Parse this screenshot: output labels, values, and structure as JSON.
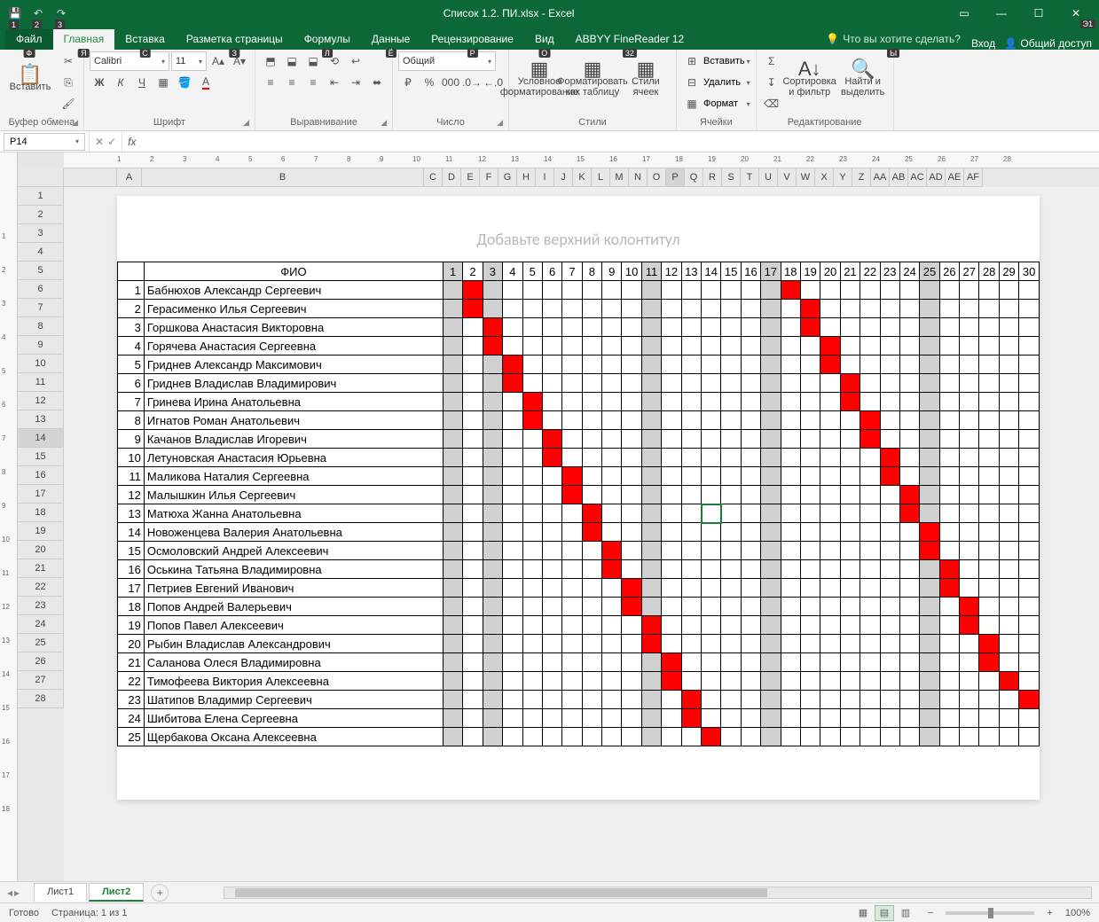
{
  "title": "Список 1.2. ПИ.xlsx - Excel",
  "qat_keys": [
    "1",
    "2",
    "3"
  ],
  "ribbon": {
    "tabs": [
      "Файл",
      "Главная",
      "Вставка",
      "Разметка страницы",
      "Формулы",
      "Данные",
      "Рецензирование",
      "Вид",
      "ABBYY FineReader 12"
    ],
    "tab_keys": [
      "Ф",
      "Я",
      "С",
      "З",
      "Л",
      "Ё",
      "Р",
      "О",
      "32",
      "Ы",
      "Э1"
    ],
    "active_tab": 1,
    "tell_me": "Что вы хотите сделать?",
    "signin": "Вход",
    "share": "Общий доступ",
    "groups": {
      "clipboard": "Буфер обмена",
      "font": "Шрифт",
      "alignment": "Выравнивание",
      "number": "Число",
      "styles": "Стили",
      "cells": "Ячейки",
      "editing": "Редактирование"
    },
    "paste": "Вставить",
    "font_name": "Calibri",
    "font_size": "11",
    "number_format": "Общий",
    "cond_fmt": "Условное форматирование",
    "fmt_table": "Форматировать как таблицу",
    "cell_styles": "Стили ячеек",
    "insert": "Вставить",
    "delete": "Удалить",
    "format": "Формат",
    "sort_filter": "Сортировка и фильтр",
    "find_select": "Найти и выделить"
  },
  "namebox": "P14",
  "ruler_h": [
    1,
    2,
    3,
    4,
    5,
    6,
    7,
    8,
    9,
    10,
    11,
    12,
    13,
    14,
    15,
    16,
    17,
    18,
    19,
    20,
    21,
    22,
    23,
    24,
    25,
    26,
    27,
    28
  ],
  "ruler_v": [
    1,
    2,
    3,
    4,
    5,
    6,
    7,
    8,
    9,
    10,
    11,
    12,
    13,
    14,
    15,
    16,
    17,
    18
  ],
  "columns": [
    "A",
    "B",
    "C",
    "D",
    "E",
    "F",
    "G",
    "H",
    "I",
    "J",
    "K",
    "L",
    "M",
    "N",
    "O",
    "P",
    "Q",
    "R",
    "S",
    "T",
    "U",
    "V",
    "W",
    "X",
    "Y",
    "Z",
    "AA",
    "AB",
    "AC",
    "AD",
    "AE",
    "AF"
  ],
  "col_widths": {
    "A": 28,
    "B": 318,
    "rest": 21
  },
  "row_headers": [
    1,
    2,
    3,
    4,
    5,
    6,
    7,
    8,
    9,
    10,
    11,
    12,
    13,
    14,
    15,
    16,
    17,
    18,
    19,
    20,
    21,
    22,
    23,
    24,
    25,
    26,
    27,
    28
  ],
  "selected_row": 14,
  "selected_col": "P",
  "header_placeholder": "Добавьте верхний колонтитул",
  "table": {
    "fio_header": "ФИО",
    "days": [
      1,
      2,
      3,
      4,
      5,
      6,
      7,
      8,
      9,
      10,
      11,
      12,
      13,
      14,
      15,
      16,
      17,
      18,
      19,
      20,
      21,
      22,
      23,
      24,
      25,
      26,
      27,
      28,
      29,
      30
    ],
    "gray_days": [
      1,
      3,
      11,
      17,
      25
    ],
    "students": [
      {
        "n": 1,
        "name": "Бабнюхов Александр Сергеевич",
        "reds": [
          2,
          18
        ]
      },
      {
        "n": 2,
        "name": "Герасименко Илья Сергеевич",
        "reds": [
          2,
          19
        ]
      },
      {
        "n": 3,
        "name": "Горшкова Анастасия Викторовна",
        "reds": [
          3,
          19
        ]
      },
      {
        "n": 4,
        "name": "Горячева Анастасия Сергеевна",
        "reds": [
          3,
          20
        ]
      },
      {
        "n": 5,
        "name": "Гриднев Александр Максимович",
        "reds": [
          4,
          20
        ]
      },
      {
        "n": 6,
        "name": "Гриднев Владислав Владимирович",
        "reds": [
          4,
          21
        ]
      },
      {
        "n": 7,
        "name": "Гринева Ирина Анатольевна",
        "reds": [
          5,
          21
        ]
      },
      {
        "n": 8,
        "name": "Игнатов Роман Анатольевич",
        "reds": [
          5,
          22
        ]
      },
      {
        "n": 9,
        "name": "Качанов Владислав Игоревич",
        "reds": [
          6,
          22
        ]
      },
      {
        "n": 10,
        "name": "Летуновская Анастасия Юрьевна",
        "reds": [
          6,
          23
        ]
      },
      {
        "n": 11,
        "name": "Маликова Наталия Сергеевна",
        "reds": [
          7,
          23
        ]
      },
      {
        "n": 12,
        "name": "Малышкин Илья Сергеевич",
        "reds": [
          7,
          24
        ]
      },
      {
        "n": 13,
        "name": "Матюха Жанна Анатольевна",
        "reds": [
          8,
          24
        ]
      },
      {
        "n": 14,
        "name": "Новоженцева Валерия Анатольевна",
        "reds": [
          8,
          25
        ]
      },
      {
        "n": 15,
        "name": "Осмоловский Андрей Алексеевич",
        "reds": [
          9,
          25
        ]
      },
      {
        "n": 16,
        "name": "Оськина Татьяна Владимировна",
        "reds": [
          9,
          26
        ]
      },
      {
        "n": 17,
        "name": "Петриев Евгений Иванович",
        "reds": [
          10,
          26
        ]
      },
      {
        "n": 18,
        "name": "Попов Андрей Валерьевич",
        "reds": [
          10,
          27
        ]
      },
      {
        "n": 19,
        "name": "Попов Павел Алексеевич",
        "reds": [
          11,
          27
        ]
      },
      {
        "n": 20,
        "name": "Рыбин Владислав Александрович",
        "reds": [
          11,
          28
        ]
      },
      {
        "n": 21,
        "name": "Саланова Олеся Владимировна",
        "reds": [
          12,
          28
        ]
      },
      {
        "n": 22,
        "name": "Тимофеева Виктория Алексеевна",
        "reds": [
          12,
          29
        ]
      },
      {
        "n": 23,
        "name": "Шатипов Владимир Сергеевич",
        "reds": [
          13,
          30
        ]
      },
      {
        "n": 24,
        "name": "Шибитова Елена Сергеевна",
        "reds": [
          13
        ]
      },
      {
        "n": 25,
        "name": "Щербакова Оксана Алексеевна",
        "reds": [
          14
        ]
      }
    ]
  },
  "sheets": [
    "Лист1",
    "Лист2"
  ],
  "active_sheet": 1,
  "status": {
    "ready": "Готово",
    "page": "Страница: 1 из 1",
    "zoom": "100%"
  }
}
